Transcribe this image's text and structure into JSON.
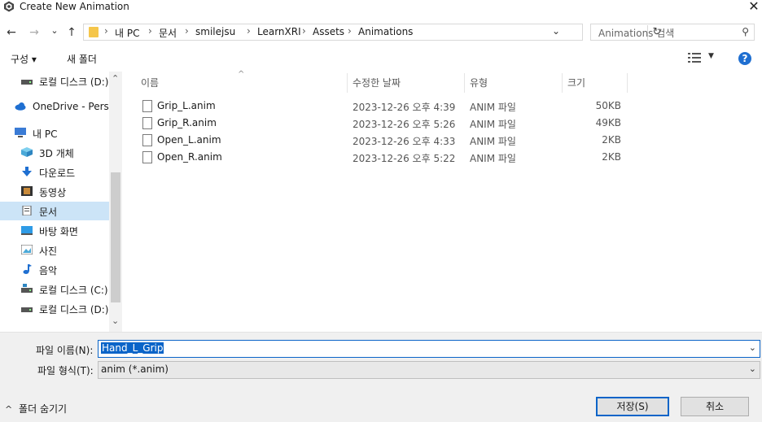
{
  "window": {
    "title": "Create New Animation",
    "close_glyph": "✕"
  },
  "nav": {
    "back": "←",
    "forward": "→",
    "recent": "⌄",
    "up": "↑"
  },
  "address": {
    "crumbs": [
      "내 PC",
      "문서",
      "smilejsu",
      "LearnXRI",
      "Assets",
      "Animations"
    ],
    "separator": "›",
    "refresh": "↻",
    "dropdown": "⌄"
  },
  "search": {
    "placeholder": "Animations 검색",
    "icon": "⚲"
  },
  "toolbar": {
    "organize": "구성 ▾",
    "new_folder": "새 폴더",
    "view_dropdown": "▼",
    "help": "?"
  },
  "navpane": {
    "items": [
      {
        "label": "로컬 디스크 (D:)",
        "icon": "drive-icon"
      },
      {
        "label": "OneDrive - Person",
        "icon": "cloud-icon"
      },
      {
        "label": "내 PC",
        "icon": "pc-icon"
      },
      {
        "label": "3D 개체",
        "icon": "cube-icon"
      },
      {
        "label": "다운로드",
        "icon": "download-icon"
      },
      {
        "label": "동영상",
        "icon": "film-icon"
      },
      {
        "label": "문서",
        "icon": "document-icon"
      },
      {
        "label": "바탕 화면",
        "icon": "desktop-icon"
      },
      {
        "label": "사진",
        "icon": "picture-icon"
      },
      {
        "label": "음악",
        "icon": "music-icon"
      },
      {
        "label": "로컬 디스크 (C:)",
        "icon": "drive-icon"
      },
      {
        "label": "로컬 디스크 (D:)",
        "icon": "drive-icon"
      }
    ],
    "selected": "문서",
    "scroll_up": "⌃",
    "scroll_down": "⌄"
  },
  "columns": {
    "name": "이름",
    "date": "수정한 날짜",
    "type": "유형",
    "size": "크기",
    "sort_glyph": "^"
  },
  "files": [
    {
      "name": "Grip_L.anim",
      "date": "2023-12-26 오후 4:39",
      "type": "ANIM 파일",
      "size": "50KB"
    },
    {
      "name": "Grip_R.anim",
      "date": "2023-12-26 오후 5:26",
      "type": "ANIM 파일",
      "size": "49KB"
    },
    {
      "name": "Open_L.anim",
      "date": "2023-12-26 오후 4:33",
      "type": "ANIM 파일",
      "size": "2KB"
    },
    {
      "name": "Open_R.anim",
      "date": "2023-12-26 오후 5:22",
      "type": "ANIM 파일",
      "size": "2KB"
    }
  ],
  "form": {
    "filename_label": "파일 이름(N):",
    "filename_value": "Hand_L_Grip",
    "filetype_label": "파일 형식(T):",
    "filetype_value": "anim (*.anim)",
    "dropdown": "⌄"
  },
  "footer": {
    "hide_folders": "폴더 숨기기",
    "hide_glyph": "^",
    "save": "저장(S)",
    "cancel": "취소"
  },
  "colors": {
    "accent": "#0a64c8",
    "help": "#1f6fd1",
    "selected_nav": "#cce4f7",
    "folder": "#f5c64a"
  }
}
